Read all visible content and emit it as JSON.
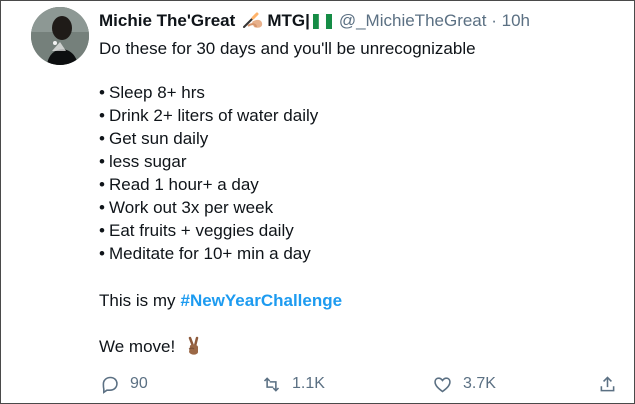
{
  "tweet": {
    "author": {
      "display_name": "Michie The'Great",
      "name_suffix": "MTG|",
      "handle": "@_MichieTheGreat",
      "separator": "·",
      "time": "10h"
    },
    "lines": [
      "Do these for 30 days and you'll be unrecognizable"
    ],
    "bullets": [
      "Sleep 8+ hrs",
      "Drink 2+ liters of water daily",
      "Get sun daily",
      "less sugar",
      "Read 1 hour+ a day",
      "Work out 3x per week",
      "Eat fruits + veggies daily",
      "Meditate for 10+ min a day"
    ],
    "bullet_symbol": "•",
    "closing_line_prefix": "This is my",
    "hashtag": "#NewYearChallenge",
    "final_line": "We move!",
    "metrics": {
      "replies": "90",
      "retweets": "1.1K",
      "likes": "3.7K"
    }
  },
  "icons": {
    "writing_hand": "writing-hand-icon",
    "nigeria_flag": "nigeria-flag-icon",
    "victory_hand": "victory-hand-icon",
    "reply": "reply-icon",
    "retweet": "retweet-icon",
    "like": "heart-icon",
    "share": "share-icon"
  },
  "colors": {
    "primary_text": "#0f1419",
    "secondary_text": "#5b7083",
    "hashtag": "#1d9bf0",
    "border": "#4a4a4a"
  }
}
